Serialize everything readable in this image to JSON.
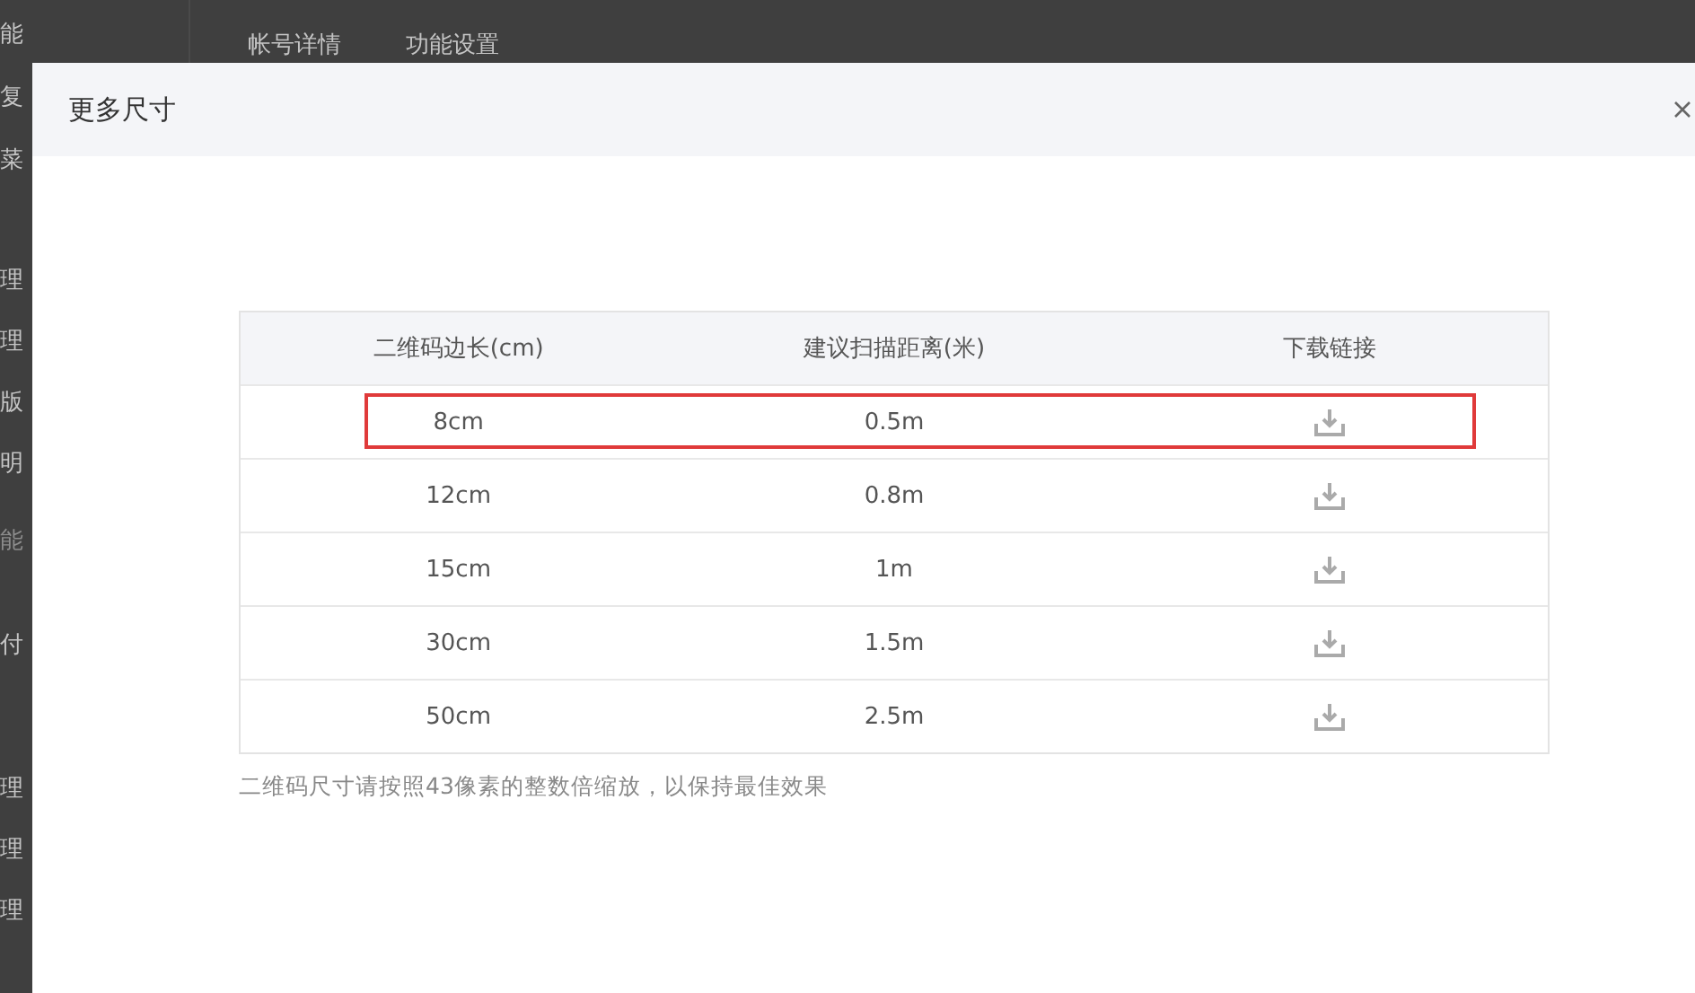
{
  "sidebar": {
    "items": [
      {
        "label": "能",
        "disabled": false
      },
      {
        "label": "复",
        "disabled": false
      },
      {
        "label": "菜",
        "disabled": false
      },
      {
        "label": "理",
        "disabled": false
      },
      {
        "label": "理",
        "disabled": false
      },
      {
        "label": "版",
        "disabled": false
      },
      {
        "label": "明",
        "disabled": false
      },
      {
        "label": "能",
        "disabled": true
      },
      {
        "label": "付",
        "disabled": false
      },
      {
        "label": "理",
        "disabled": false
      },
      {
        "label": "理",
        "disabled": false
      },
      {
        "label": "理",
        "disabled": false
      }
    ]
  },
  "tabs": [
    {
      "label": "帐号详情"
    },
    {
      "label": "功能设置"
    }
  ],
  "dialog": {
    "title": "更多尺寸",
    "table": {
      "columns": [
        "二维码边长(cm)",
        "建议扫描距离(米)",
        "下载链接"
      ],
      "rows": [
        {
          "size": "8cm",
          "distance": "0.5m",
          "selected": true
        },
        {
          "size": "12cm",
          "distance": "0.8m",
          "selected": false
        },
        {
          "size": "15cm",
          "distance": "1m",
          "selected": false
        },
        {
          "size": "30cm",
          "distance": "1.5m",
          "selected": false
        },
        {
          "size": "50cm",
          "distance": "2.5m",
          "selected": false
        }
      ]
    },
    "note": "二维码尺寸请按照43像素的整数倍缩放，以保持最佳效果"
  }
}
